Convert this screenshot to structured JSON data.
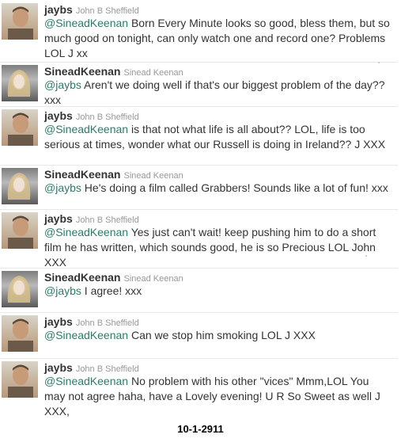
{
  "tweets": [
    {
      "handle": "jaybs",
      "fullname": "John B Sheffield",
      "avatar": "john-avatar",
      "mention": "@SineadKeenan",
      "text": " Born Every Minute looks so good, bless them, but so much good on tonight, can only watch one and record one? Problems LOL J xx"
    },
    {
      "handle": "SineadKeenan",
      "fullname": "Sinead Keenan",
      "avatar": "sinead-avatar",
      "mention": "@jaybs",
      "text": " Aren't we doing well if that's our biggest problem of the day?? xxx"
    },
    {
      "handle": "jaybs",
      "fullname": "John B Sheffield",
      "avatar": "john-avatar",
      "mention": "@SineadKeenan",
      "text": " is that not what life is all about?? LOL, life is too serious at times, wonder what our Russell is doing in Ireland?? J XXX"
    },
    {
      "handle": "SineadKeenan",
      "fullname": "Sinead Keenan",
      "avatar": "sinead-avatar",
      "mention": "@jaybs",
      "text": " He's doing a film called Grabbers! Sounds like a lot of fun! xxx"
    },
    {
      "handle": "jaybs",
      "fullname": "John B Sheffield",
      "avatar": "john-avatar",
      "mention": "@SineadKeenan",
      "text": " Yes just can't wait! keep pushing him to do a short film he has written, which sounds good, he is so Precious LOL John XXX"
    },
    {
      "handle": "SineadKeenan",
      "fullname": "Sinead Keenan",
      "avatar": "sinead-avatar",
      "mention": "@jaybs",
      "text": " I agree! xxx"
    },
    {
      "handle": "jaybs",
      "fullname": "John B Sheffield",
      "avatar": "john-avatar",
      "mention": "@SineadKeenan",
      "text": " Can we stop him smoking LOL J XXX"
    },
    {
      "handle": "jaybs",
      "fullname": "John B Sheffield",
      "avatar": "john-avatar",
      "mention": "@SineadKeenan",
      "text": " No problem with his other \"vices\" Mmm,LOL You may not agree haha, have a Lovely evening! U R So Sweet as well J XXX,"
    }
  ],
  "footer": "10-1-2911",
  "colors": {
    "mention": "#2b7b6a",
    "handle": "#333333",
    "fullname": "#999999"
  }
}
